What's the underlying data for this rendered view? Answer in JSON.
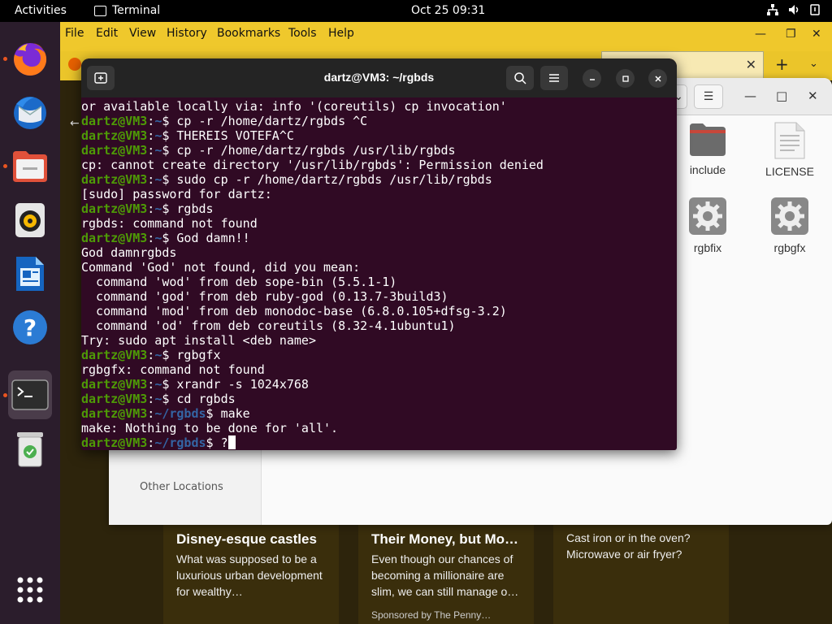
{
  "topbar": {
    "activities": "Activities",
    "app_name": "Terminal",
    "clock": "Oct 25  09:31"
  },
  "firefox": {
    "menus": [
      "File",
      "Edit",
      "View",
      "History",
      "Bookmarks",
      "Tools",
      "Help"
    ],
    "cards": [
      {
        "title": "Disney-esque castles",
        "desc": "What was supposed to be a luxurious urban development for wealthy…",
        "sponsor": ""
      },
      {
        "title": "Their Money, but Mo…",
        "desc": "Even though our chances of becoming a millionaire are slim, we can still manage o…",
        "sponsor": "Sponsored by The Penny…"
      },
      {
        "title": "",
        "desc": "Cast iron or in the oven? Microwave or air fryer?",
        "sponsor": ""
      }
    ]
  },
  "files": {
    "items": [
      {
        "label": "include",
        "icon": "folder-icon"
      },
      {
        "label": "LICENSE",
        "icon": "text-file-icon"
      },
      {
        "label": "rgbfix",
        "icon": "executable-gear-icon"
      },
      {
        "label": "rgbgfx",
        "icon": "executable-gear-icon"
      }
    ],
    "sidebar_other": "Other Locations"
  },
  "terminal": {
    "title": "dartz@VM3: ~/rgbds",
    "prompt_user": "dartz@VM3",
    "lines": [
      {
        "text": "or available locally via: info '(coreutils) cp invocation'"
      },
      {
        "path": "~",
        "cmd": "cp -r /home/dartz/rgbds ^C"
      },
      {
        "path": "~",
        "cmd": "THEREIS VOTEFA^C"
      },
      {
        "path": "~",
        "cmd": "cp -r /home/dartz/rgbds /usr/lib/rgbds"
      },
      {
        "text": "cp: cannot create directory '/usr/lib/rgbds': Permission denied"
      },
      {
        "path": "~",
        "cmd": "sudo cp -r /home/dartz/rgbds /usr/lib/rgbds"
      },
      {
        "text": "[sudo] password for dartz:"
      },
      {
        "path": "~",
        "cmd": "rgbds"
      },
      {
        "text": "rgbds: command not found"
      },
      {
        "path": "~",
        "cmd": "God damn!!"
      },
      {
        "text": "God damnrgbds"
      },
      {
        "text": "Command 'God' not found, did you mean:"
      },
      {
        "text": "  command 'wod' from deb sope-bin (5.5.1-1)"
      },
      {
        "text": "  command 'god' from deb ruby-god (0.13.7-3build3)"
      },
      {
        "text": "  command 'mod' from deb monodoc-base (6.8.0.105+dfsg-3.2)"
      },
      {
        "text": "  command 'od' from deb coreutils (8.32-4.1ubuntu1)"
      },
      {
        "text": "Try: sudo apt install <deb name>"
      },
      {
        "path": "~",
        "cmd": "rgbgfx"
      },
      {
        "text": "rgbgfx: command not found"
      },
      {
        "path": "~",
        "cmd": "xrandr -s 1024x768"
      },
      {
        "path": "~",
        "cmd": "cd rgbds"
      },
      {
        "path": "~/rgbds",
        "cmd": "make"
      },
      {
        "text": "make: Nothing to be done for 'all'."
      },
      {
        "path": "~/rgbds",
        "cmd": "?",
        "cursor": true
      }
    ]
  }
}
